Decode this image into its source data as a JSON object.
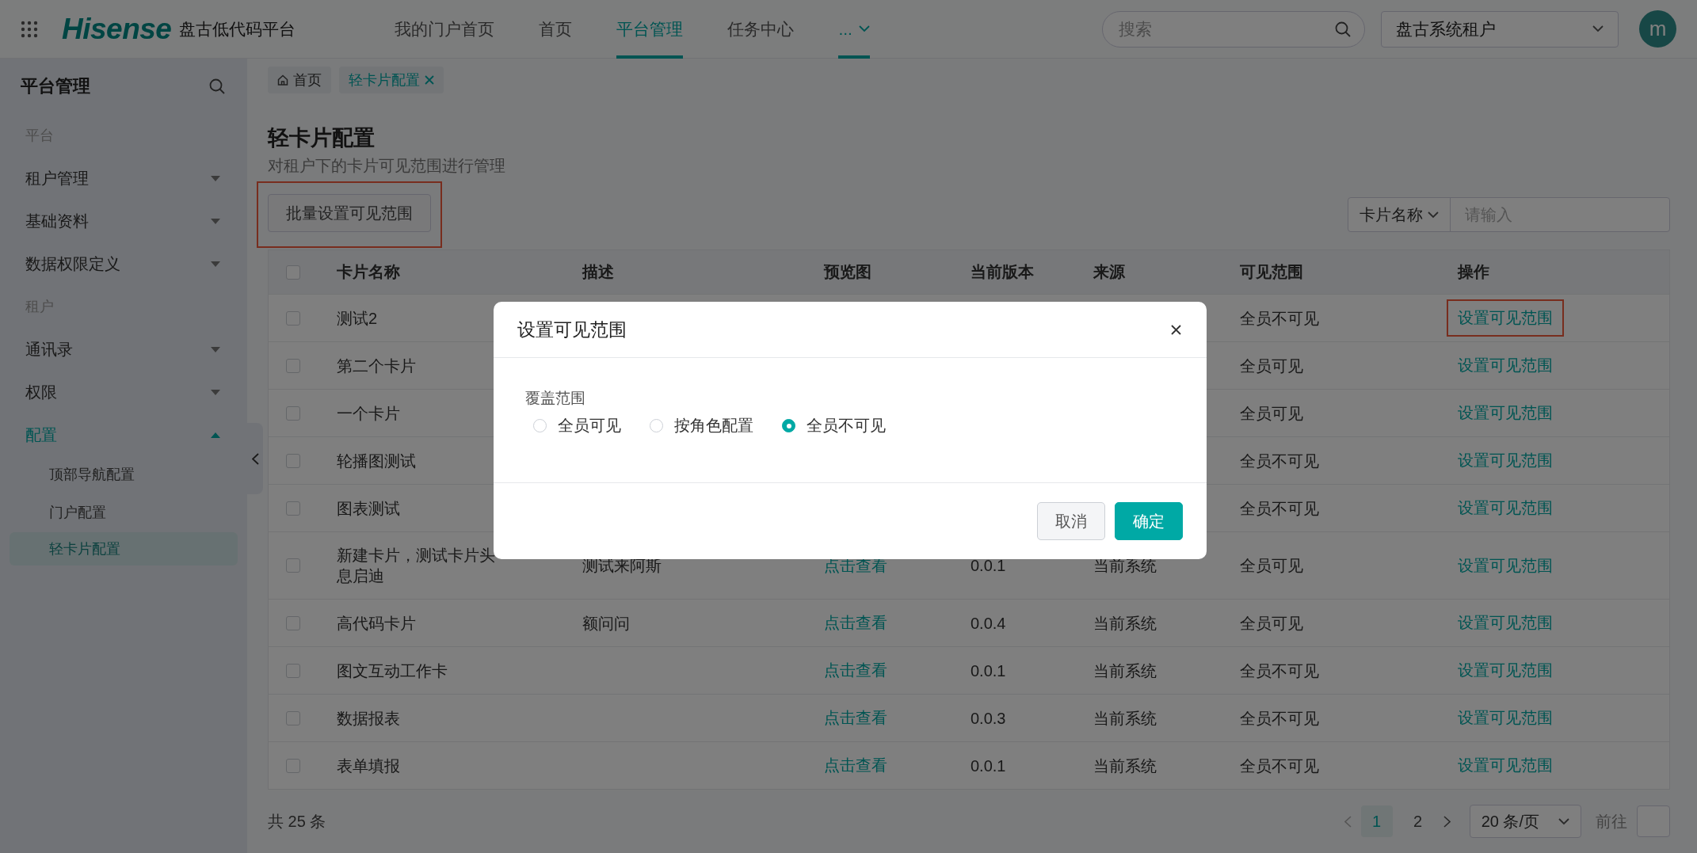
{
  "header": {
    "logo": "Hisense",
    "app_name": "盘古低代码平台",
    "nav": [
      {
        "label": "我的门户首页",
        "selected": false
      },
      {
        "label": "首页",
        "selected": false
      },
      {
        "label": "平台管理",
        "selected": true
      },
      {
        "label": "任务中心",
        "selected": false
      },
      {
        "label": "...",
        "selected": true,
        "kind": "more"
      }
    ],
    "search": {
      "placeholder": "搜索"
    },
    "tenant": "盘古系统租户",
    "avatar": "m"
  },
  "sidebar": {
    "title": "平台管理",
    "items": [
      {
        "label": "平台",
        "kind": "group"
      },
      {
        "label": "租户管理",
        "kind": "menu",
        "expanded": false
      },
      {
        "label": "基础资料",
        "kind": "menu",
        "expanded": false
      },
      {
        "label": "数据权限定义",
        "kind": "menu",
        "expanded": false
      },
      {
        "label": "租户",
        "kind": "group"
      },
      {
        "label": "通讯录",
        "kind": "menu",
        "expanded": false
      },
      {
        "label": "权限",
        "kind": "menu",
        "expanded": false
      },
      {
        "label": "配置",
        "kind": "menu",
        "expanded": true,
        "children": [
          {
            "label": "顶部导航配置",
            "selected": false
          },
          {
            "label": "门户配置",
            "selected": false
          },
          {
            "label": "轻卡片配置",
            "selected": true
          }
        ]
      }
    ]
  },
  "breadcrumbs": [
    {
      "label": "首页",
      "kind": "home",
      "selected": false
    },
    {
      "label": "轻卡片配置",
      "kind": "closable",
      "selected": true
    }
  ],
  "page": {
    "title": "轻卡片配置",
    "subtitle": "对租户下的卡片可见范围进行管理",
    "batch_button": {
      "label": "批量设置可见范围",
      "highlighted": true
    },
    "filter": {
      "field": "卡片名称",
      "placeholder": "请输入"
    }
  },
  "table": {
    "select_all_checked": false,
    "columns": [
      "卡片名称",
      "描述",
      "预览图",
      "当前版本",
      "来源",
      "可见范围",
      "操作"
    ],
    "rows": [
      {
        "checked": false,
        "name": "测试2",
        "scope": "全员不可见",
        "action": "设置可见范围",
        "highlighted": true
      },
      {
        "checked": false,
        "name": "第二个卡片",
        "scope": "全员可见",
        "action": "设置可见范围"
      },
      {
        "checked": false,
        "name": "一个卡片",
        "scope": "全员可见",
        "action": "设置可见范围"
      },
      {
        "checked": false,
        "name": "轮播图测试",
        "scope": "全员不可见",
        "action": "设置可见范围"
      },
      {
        "checked": false,
        "name": "图表测试",
        "scope": "全员不可见",
        "action": "设置可见范围"
      },
      {
        "checked": false,
        "name": "新建卡片，测试卡片头息启迪",
        "description": "测试来阿斯",
        "preview": "点击查看",
        "version": "0.0.1",
        "source": "当前系统",
        "scope": "全员可见",
        "action": "设置可见范围"
      },
      {
        "checked": false,
        "name": "高代码卡片",
        "description": "额问问",
        "preview": "点击查看",
        "version": "0.0.4",
        "source": "当前系统",
        "scope": "全员可见",
        "action": "设置可见范围"
      },
      {
        "checked": false,
        "name": "图文互动工作卡",
        "preview": "点击查看",
        "version": "0.0.1",
        "source": "当前系统",
        "scope": "全员不可见",
        "action": "设置可见范围"
      },
      {
        "checked": false,
        "name": "数据报表",
        "preview": "点击查看",
        "version": "0.0.3",
        "source": "当前系统",
        "scope": "全员不可见",
        "action": "设置可见范围"
      },
      {
        "checked": false,
        "name": "表单填报",
        "preview": "点击查看",
        "version": "0.0.1",
        "source": "当前系统",
        "scope": "全员不可见",
        "action": "设置可见范围"
      }
    ]
  },
  "pagination": {
    "total": "共 25 条",
    "pages": [
      {
        "label": "1",
        "selected": true
      },
      {
        "label": "2",
        "selected": false
      }
    ],
    "page_size": "20 条/页",
    "goto_label": "前往"
  },
  "dialog": {
    "title": "设置可见范围",
    "field_label": "覆盖范围",
    "options": [
      {
        "label": "全员可见",
        "selected": false
      },
      {
        "label": "按角色配置",
        "selected": false
      },
      {
        "label": "全员不可见",
        "selected": true
      }
    ],
    "buttons": [
      {
        "label": "取消",
        "kind": "secondary"
      },
      {
        "label": "确定",
        "kind": "primary"
      }
    ]
  }
}
